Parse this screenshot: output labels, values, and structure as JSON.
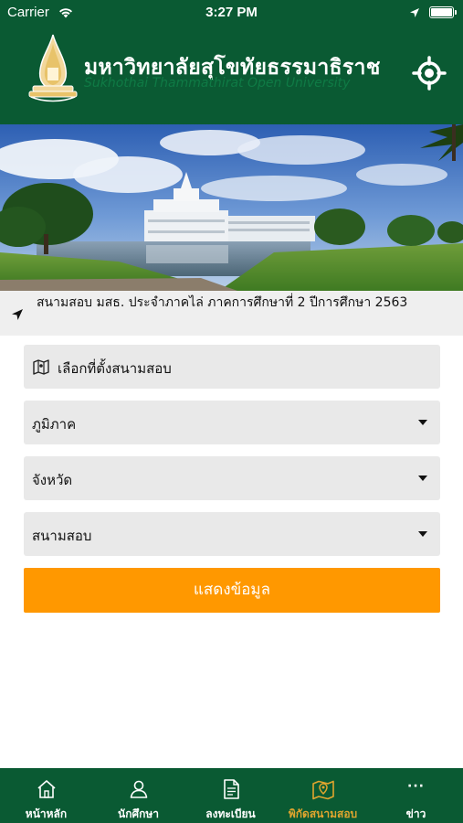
{
  "status_bar": {
    "carrier": "Carrier",
    "time": "3:27 PM"
  },
  "header": {
    "title_th": "มหาวิทยาลัยสุโขทัยธรรมาธิราช",
    "title_en": "Sukhothai Thammathirat Open University",
    "logo_icon": "university-emblem-icon",
    "locate_icon": "locate-crosshair-icon"
  },
  "notice": {
    "icon": "location-arrow-icon",
    "text": "สนามสอบ มสธ. ประจำภาคไล่ ภาคการศึกษาที่ 2 ปีการศึกษา 2563"
  },
  "form": {
    "heading": "เลือกที่ตั้งสนามสอบ",
    "heading_icon": "map-icon",
    "region_label": "ภูมิภาค",
    "province_label": "จังหวัด",
    "exam_site_label": "สนามสอบ",
    "submit_label": "แสดงข้อมูล"
  },
  "tabbar": {
    "tabs": [
      {
        "label": "หน้าหลัก",
        "icon": "home-icon"
      },
      {
        "label": "นักศึกษา",
        "icon": "user-icon"
      },
      {
        "label": "ลงทะเบียน",
        "icon": "document-icon"
      },
      {
        "label": "พิกัดสนามสอบ",
        "icon": "map-pin-icon"
      },
      {
        "label": "ข่าว",
        "icon": "more-icon",
        "glyph": "···"
      }
    ],
    "active_index": 3
  },
  "colors": {
    "brand_green": "#0a5a33",
    "accent_orange": "#ff9800",
    "active_tab": "#e0a52e",
    "field_bg": "#e9e9e9"
  }
}
